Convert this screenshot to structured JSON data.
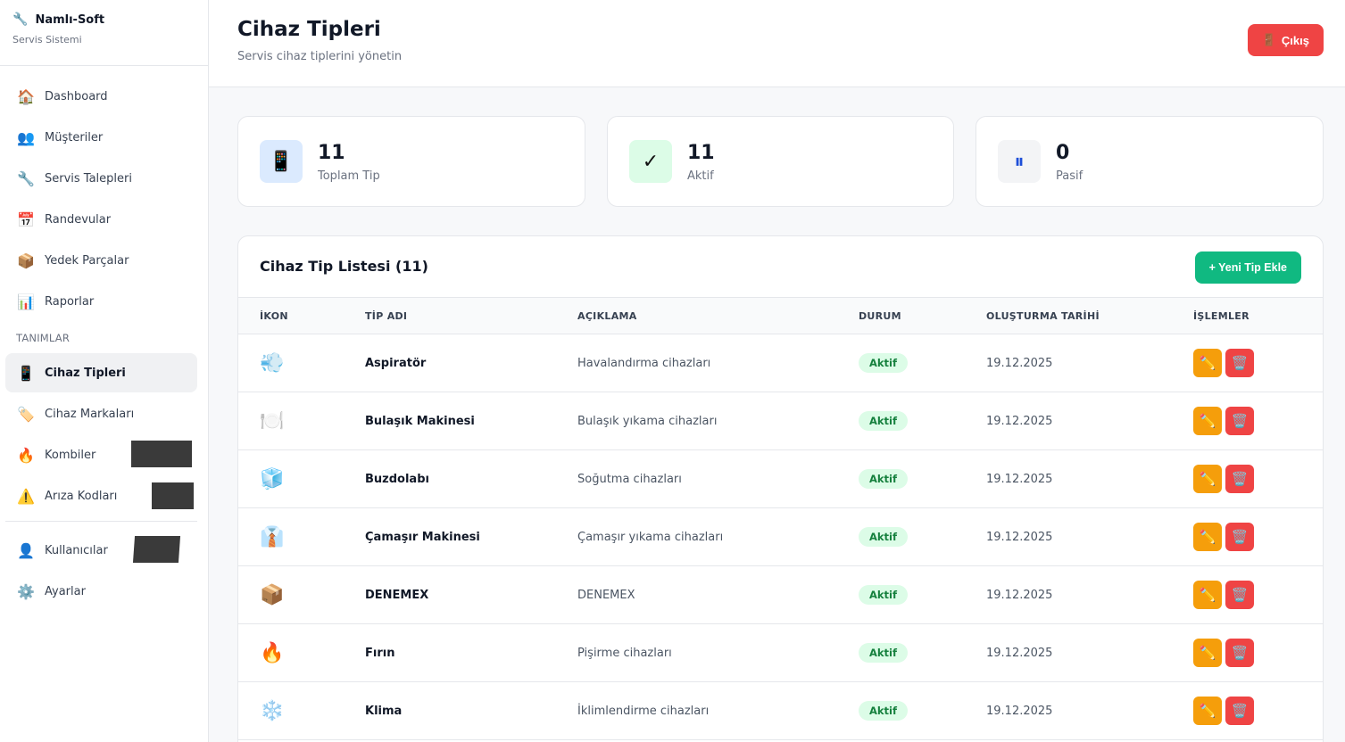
{
  "brand": {
    "title": "Namlı-Soft",
    "subtitle": "Servis Sistemi",
    "icon": "wrench-icon"
  },
  "sidebar": {
    "items": [
      {
        "label": "Dashboard",
        "icon": "🏠"
      },
      {
        "label": "Müşteriler",
        "icon": "👥"
      },
      {
        "label": "Servis Talepleri",
        "icon": "🔧"
      },
      {
        "label": "Randevular",
        "icon": "📅"
      },
      {
        "label": "Yedek Parçalar",
        "icon": "📦"
      },
      {
        "label": "Raporlar",
        "icon": "📊"
      }
    ],
    "section_label": "TANIMLAR",
    "definitions": [
      {
        "label": "Cihaz Tipleri",
        "icon": "📱"
      },
      {
        "label": "Cihaz Markaları",
        "icon": "🏷️"
      },
      {
        "label": "Kombiler",
        "icon": "🔥"
      },
      {
        "label": "Arıza Kodları",
        "icon": "⚠️"
      }
    ],
    "bottom": [
      {
        "label": "Kullanıcılar",
        "icon": "👤"
      },
      {
        "label": "Ayarlar",
        "icon": "⚙️"
      }
    ]
  },
  "header": {
    "title": "Cihaz Tipleri",
    "subtitle": "Servis cihaz tiplerini yönetin",
    "logout_label": "Çıkış",
    "logout_icon": "🚪"
  },
  "stats": [
    {
      "value": "11",
      "label": "Toplam Tip",
      "icon": "📱"
    },
    {
      "value": "11",
      "label": "Aktif",
      "icon": "✓"
    },
    {
      "value": "0",
      "label": "Pasif",
      "icon": "⏸"
    }
  ],
  "list": {
    "title": "Cihaz Tip Listesi (11)",
    "add_label": "+ Yeni Tip Ekle",
    "columns": [
      "İKON",
      "TİP ADI",
      "AÇIKLAMA",
      "DURUM",
      "OLUŞTURMA TARİHİ",
      "İŞLEMLER"
    ],
    "rows": [
      {
        "icon": "💨",
        "name": "Aspiratör",
        "desc": "Havalandırma cihazları",
        "status": "Aktif",
        "date": "19.12.2025"
      },
      {
        "icon": "🍽️",
        "name": "Bulaşık Makinesi",
        "desc": "Bulaşık yıkama cihazları",
        "status": "Aktif",
        "date": "19.12.2025"
      },
      {
        "icon": "🧊",
        "name": "Buzdolabı",
        "desc": "Soğutma cihazları",
        "status": "Aktif",
        "date": "19.12.2025"
      },
      {
        "icon": "👔",
        "name": "Çamaşır Makinesi",
        "desc": "Çamaşır yıkama cihazları",
        "status": "Aktif",
        "date": "19.12.2025"
      },
      {
        "icon": "📦",
        "name": "DENEMEX",
        "desc": "DENEMEX",
        "status": "Aktif",
        "date": "19.12.2025"
      },
      {
        "icon": "🔥",
        "name": "Fırın",
        "desc": "Pişirme cihazları",
        "status": "Aktif",
        "date": "19.12.2025"
      },
      {
        "icon": "❄️",
        "name": "Klima",
        "desc": "İklimlendirme cihazları",
        "status": "Aktif",
        "date": "19.12.2025"
      }
    ],
    "edit_icon": "✏️",
    "delete_icon": "🗑️"
  }
}
